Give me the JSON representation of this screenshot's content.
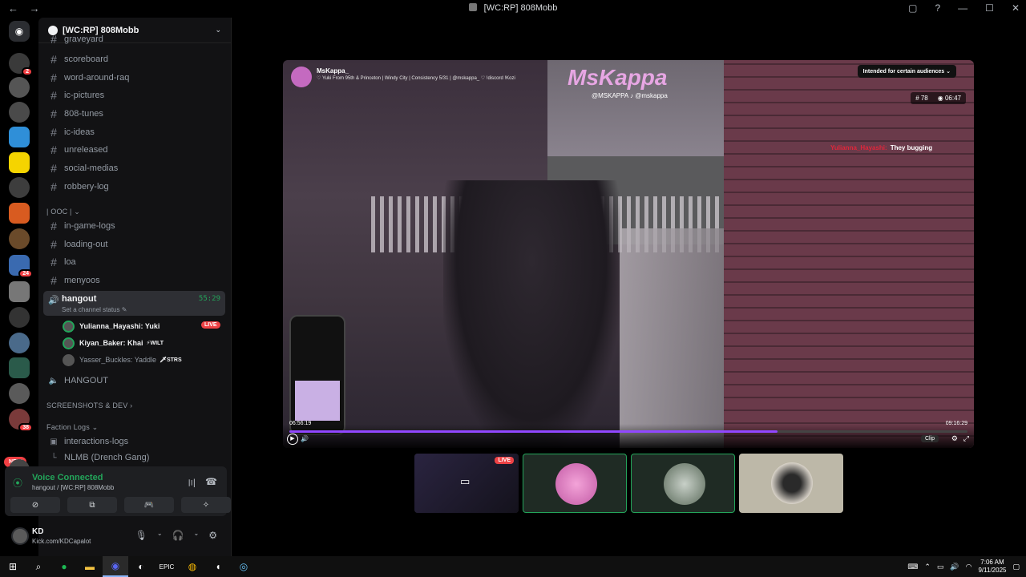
{
  "window": {
    "title": "[WC:RP] 808Mobb",
    "back": "←",
    "forward": "→",
    "inbox_icon": "▢",
    "help_icon": "?",
    "minimize": "—",
    "maximize": "☐",
    "close": "✕"
  },
  "servers": {
    "badges": [
      "2",
      "24",
      "38"
    ],
    "new_label": "NEW",
    "icon_colors": [
      "#3a3a3a",
      "#555",
      "#4a4a4a",
      "#2f8fd8",
      "#f5d400",
      "#3d3d3d",
      "#d85b20",
      "#6a4a2a",
      "#3a6ab0",
      "#777",
      "#333",
      "#4a6a8a",
      "#2a5a4a",
      "#5a5a5a",
      "#7a3a3a",
      "#444"
    ]
  },
  "sidebar": {
    "guild_name": "[WC:RP] 808Mobb",
    "channels_top": [
      {
        "name": "graveyard"
      },
      {
        "name": "scoreboard"
      },
      {
        "name": "word-around-raq"
      },
      {
        "name": "ic-pictures"
      },
      {
        "name": "808-tunes"
      },
      {
        "name": "ic-ideas"
      },
      {
        "name": "unreleased"
      },
      {
        "name": "social-medias"
      },
      {
        "name": "robbery-log"
      }
    ],
    "category_ooc": "| OOC | ⌄",
    "channels_ooc": [
      {
        "name": "in-game-logs"
      },
      {
        "name": "loading-out"
      },
      {
        "name": "loa"
      },
      {
        "name": "menyoos"
      }
    ],
    "voice": {
      "name": "hangout",
      "status": "Set a channel status ✎",
      "timer": "55:29",
      "users": [
        {
          "name": "Yulianna_Hayashi: Yuki",
          "tag": "",
          "live": "LIVE"
        },
        {
          "name": "Kiyan_Baker: Khai",
          "tag": "⚡WILT",
          "live": ""
        },
        {
          "name": "Yasser_Buckles: Yaddle",
          "tag": "🗡STRS",
          "live": ""
        }
      ]
    },
    "voice2": "HANGOUT",
    "category_screens": "SCREENSHOTS & DEV  ›",
    "category_faction": "Faction Logs  ⌄",
    "faction_channels": [
      {
        "name": "interactions-logs"
      },
      {
        "name": "NLMB (Drench Gang)"
      }
    ]
  },
  "voice_panel": {
    "status": "Voice Connected",
    "location": "hangout / [WC:RP] 808Mobb"
  },
  "user_panel": {
    "name": "KD",
    "status": "Kick.com/KDCapalot"
  },
  "stream": {
    "streamer": "MsKappa_",
    "description": "♡ Yuki From 95th & Princeton | Windy City | Consistency 5/31 | @mskappa_ ♡ !discord !Kozi",
    "brand": "MsKappa",
    "brand_sub": "@MSKAPPA  ♪ @mskappa",
    "audience": "Intended for certain audiences  ⌄",
    "viewers": "78",
    "uptime": "06:47",
    "overlay_name": "Yulianna_Hayashi:",
    "overlay_text": "They bugging",
    "time_left": "06:56:19",
    "time_right": "09:16:29",
    "progress": 0.72,
    "clip_label": "Clip"
  },
  "tiles": {
    "live": "LIVE"
  },
  "taskbar": {
    "time": "7:06 AM",
    "date": "9/11/2025"
  }
}
